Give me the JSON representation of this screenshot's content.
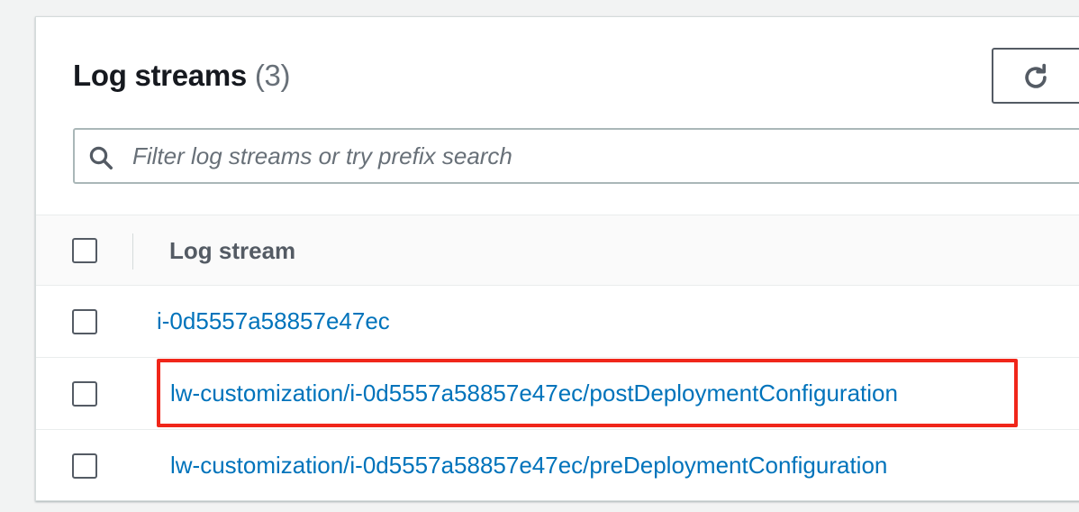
{
  "panel": {
    "title": "Log streams",
    "count": "(3)"
  },
  "refresh": {
    "icon": "refresh-icon"
  },
  "search": {
    "placeholder": "Filter log streams or try prefix search",
    "value": "",
    "icon": "search-icon"
  },
  "table": {
    "column_header": "Log stream",
    "rows": [
      {
        "name": "i-0d5557a58857e47ec"
      },
      {
        "name": "lw-customization/i-0d5557a58857e47ec/postDeploymentConfiguration"
      },
      {
        "name": "lw-customization/i-0d5557a58857e47ec/preDeploymentConfiguration"
      }
    ]
  },
  "colors": {
    "link": "#0073bb",
    "highlight": "#f0261a",
    "text": "#16191f"
  }
}
